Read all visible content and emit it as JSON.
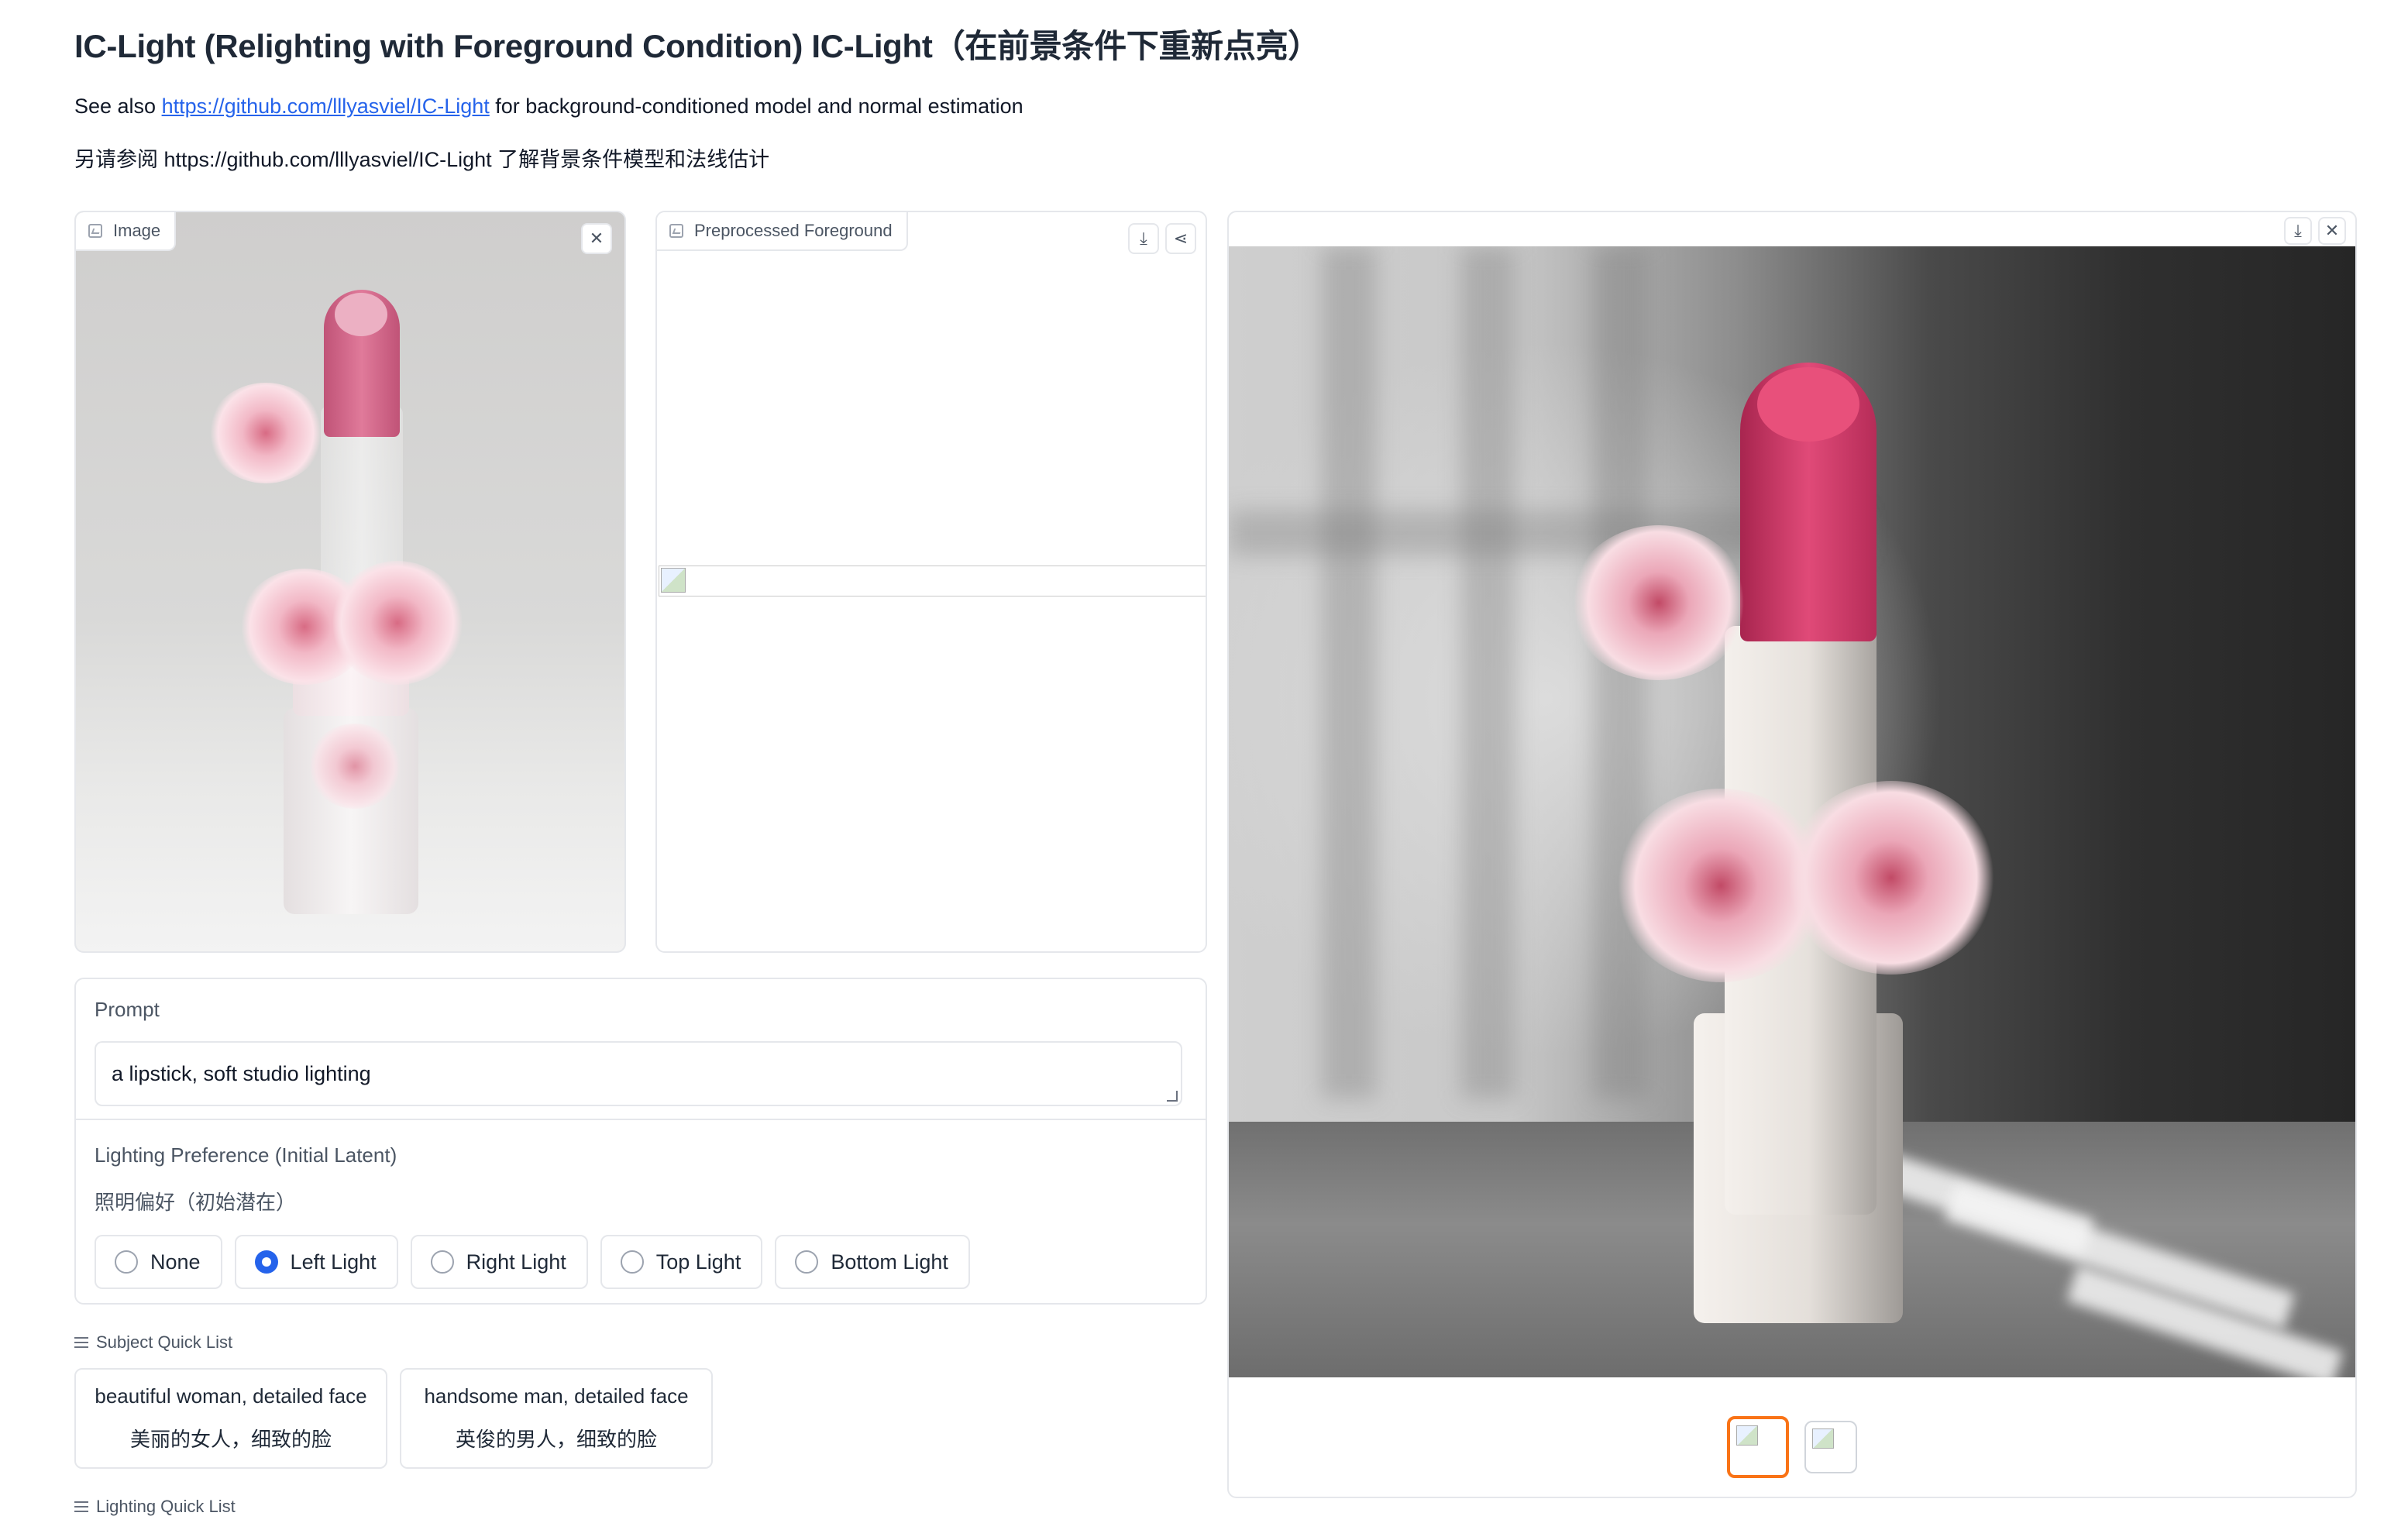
{
  "header": {
    "title": "IC-Light (Relighting with Foreground Condition) IC-Light（在前景条件下重新点亮）",
    "see_also_prefix": "See also ",
    "see_also_link": "https://github.com/lllyasviel/IC-Light",
    "see_also_suffix": " for background-conditioned model and normal estimation",
    "see_also_zh": "另请参阅 https://github.com/lllyasviel/IC-Light 了解背景条件模型和法线估计"
  },
  "image_panel": {
    "label": "Image",
    "clear_icon": "close-icon"
  },
  "preprocessed_panel": {
    "label": "Preprocessed Foreground",
    "download_icon": "download-icon",
    "share_icon": "share-icon"
  },
  "output_panel": {
    "download_icon": "download-icon",
    "close_icon": "close-icon",
    "thumbnails_count": 2,
    "selected_thumbnail": 1
  },
  "prompt": {
    "label": "Prompt",
    "value": "a lipstick, soft studio lighting"
  },
  "lighting": {
    "label": "Lighting Preference (Initial Latent)",
    "label_zh": "照明偏好（初始潜在）",
    "options": [
      "None",
      "Left Light",
      "Right Light",
      "Top Light",
      "Bottom Light"
    ],
    "selected": "Left Light"
  },
  "subject_quick_list": {
    "label": "Subject Quick List",
    "items": [
      {
        "en": "beautiful woman, detailed face",
        "zh": "美丽的女人，细致的脸"
      },
      {
        "en": "handsome man, detailed face",
        "zh": "英俊的男人，细致的脸"
      }
    ]
  },
  "lighting_quick_list": {
    "label": "Lighting Quick List"
  },
  "colors": {
    "link": "#2563eb",
    "radio_selected": "#2563eb",
    "thumb_selected": "#f97316"
  }
}
